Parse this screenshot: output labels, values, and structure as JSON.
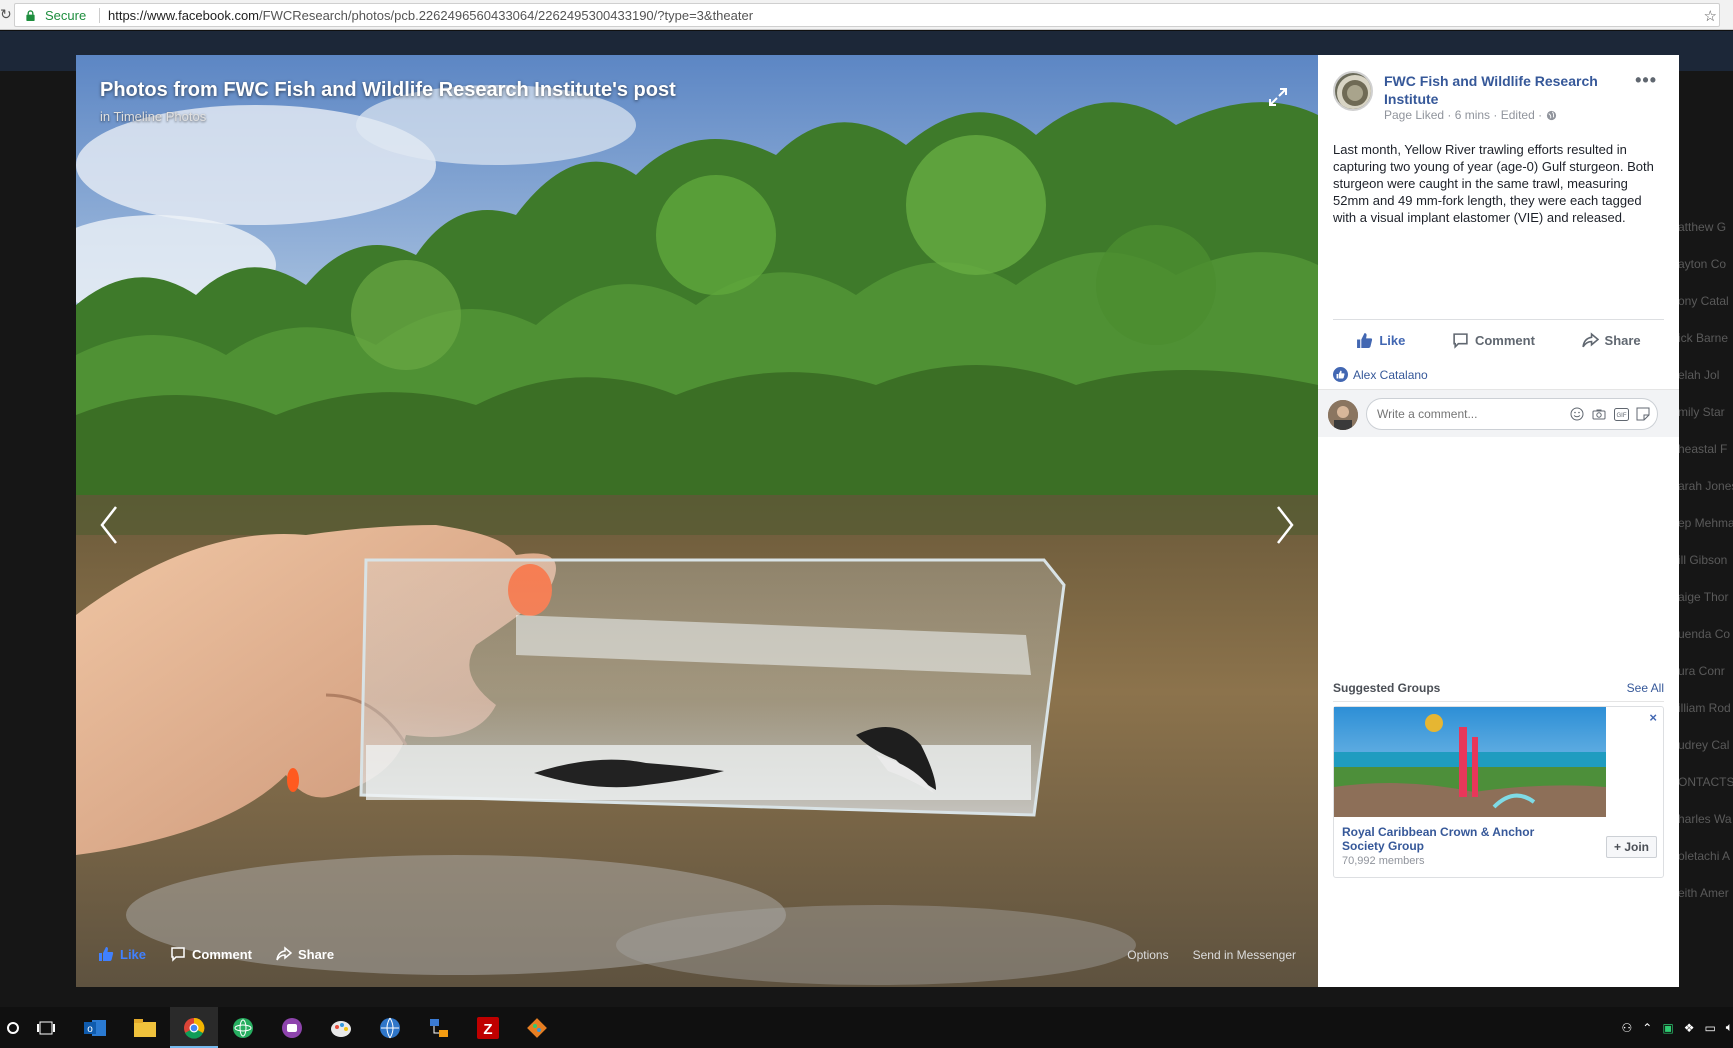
{
  "browser": {
    "secure_label": "Secure",
    "url_host": "https://www.facebook.com",
    "url_path": "/FWCResearch/photos/pcb.2262496560433064/2262495300433190/?type=3&theater"
  },
  "photo": {
    "title": "Photos from FWC Fish and Wildlife Research Institute's post",
    "subtitle": "in Timeline Photos",
    "like_label": "Like",
    "comment_label": "Comment",
    "share_label": "Share",
    "options_label": "Options",
    "messenger_label": "Send in Messenger"
  },
  "post": {
    "page_name": "FWC Fish and Wildlife Research Institute",
    "meta": "Page Liked · 6 mins · Edited ·",
    "text": "Last month, Yellow River trawling efforts resulted in capturing two young of year (age-0) Gulf sturgeon. Both sturgeon were caught in the same trawl, measuring 52mm and 49 mm-fork length, they were each tagged with a visual implant elastomer (VIE) and released.",
    "like_label": "Like",
    "comment_label": "Comment",
    "share_label": "Share",
    "liker": "Alex Catalano",
    "comment_placeholder": "Write a comment..."
  },
  "suggested_groups": {
    "title": "Suggested Groups",
    "see_all": "See All",
    "group_name": "Royal Caribbean Crown & Anchor Society Group",
    "members": "70,992 members",
    "join_label": "+ Join",
    "close_label": "×"
  },
  "background_chat": [
    "atthew G",
    "ayton Co",
    "ony Catal",
    "ick Barne",
    "elah Jol",
    "mily Star",
    "heastal F",
    "arah Jones",
    "ep Mehma",
    "ill Gibson",
    "aige Thor",
    "uenda Co",
    "ura Conr",
    "illiam Rod",
    "udrey Cal",
    "ONTACTS",
    "harles Wa",
    "oletachi A",
    "eith Amer"
  ],
  "colors": {
    "fb_blue": "#4267b2",
    "link_blue": "#365899",
    "secure_green": "#1e8e3e"
  }
}
